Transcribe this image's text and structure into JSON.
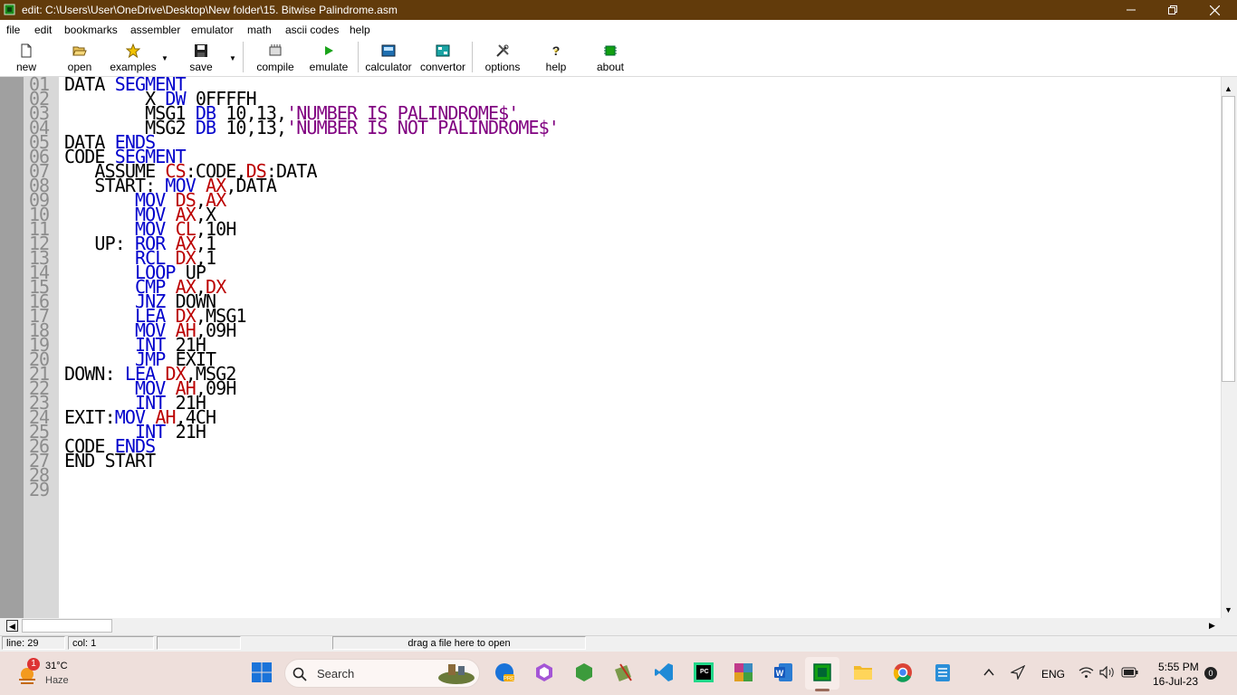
{
  "window": {
    "title": "edit: C:\\Users\\User\\OneDrive\\Desktop\\New folder\\15. Bitwise Palindrome.asm",
    "controls": [
      "minimize-icon",
      "restore-icon",
      "close-icon"
    ]
  },
  "menu": [
    "file",
    "edit",
    "bookmarks",
    "assembler",
    "emulator",
    "math",
    "ascii codes",
    "help"
  ],
  "toolbar": {
    "new": "new",
    "open": "open",
    "examples": "examples",
    "save": "save",
    "compile": "compile",
    "emulate": "emulate",
    "calculator": "calculator",
    "convertor": "convertor",
    "options": "options",
    "help": "help",
    "about": "about"
  },
  "editor": {
    "line_numbers": [
      "01",
      "02",
      "03",
      "04",
      "05",
      "06",
      "07",
      "08",
      "09",
      "10",
      "11",
      "12",
      "13",
      "14",
      "15",
      "16",
      "17",
      "18",
      "19",
      "20",
      "21",
      "22",
      "23",
      "24",
      "25",
      "26",
      "27",
      "28",
      "29"
    ],
    "lines": [
      [
        [
          "DATA ",
          "t"
        ],
        [
          "SEGMENT",
          "kw"
        ]
      ],
      [
        [
          "        X ",
          "t"
        ],
        [
          "DW",
          "kw"
        ],
        [
          " 0FFFFH",
          "t"
        ]
      ],
      [
        [
          "        MSG1 ",
          "t"
        ],
        [
          "DB",
          "kw"
        ],
        [
          " 10,13,",
          "t"
        ],
        [
          "'NUMBER IS PALINDROME$'",
          "st"
        ]
      ],
      [
        [
          "        MSG2 ",
          "t"
        ],
        [
          "DB",
          "kw"
        ],
        [
          " 10,13,",
          "t"
        ],
        [
          "'NUMBER IS NOT PALINDROME$'",
          "st"
        ]
      ],
      [
        [
          "DATA ",
          "t"
        ],
        [
          "ENDS",
          "kw"
        ]
      ],
      [
        [
          "CODE ",
          "t"
        ],
        [
          "SEGMENT",
          "kw"
        ]
      ],
      [
        [
          "   ASSUME ",
          "t"
        ],
        [
          "CS",
          "rg"
        ],
        [
          ":CODE,",
          "t"
        ],
        [
          "DS",
          "rg"
        ],
        [
          ":DATA",
          "t"
        ]
      ],
      [
        [
          "   START: ",
          "t"
        ],
        [
          "MOV",
          "kw"
        ],
        [
          " ",
          "t"
        ],
        [
          "AX",
          "rg"
        ],
        [
          ",DATA",
          "t"
        ]
      ],
      [
        [
          "       ",
          "t"
        ],
        [
          "MOV",
          "kw"
        ],
        [
          " ",
          "t"
        ],
        [
          "DS",
          "rg"
        ],
        [
          ",",
          "t"
        ],
        [
          "AX",
          "rg"
        ]
      ],
      [
        [
          "       ",
          "t"
        ],
        [
          "MOV",
          "kw"
        ],
        [
          " ",
          "t"
        ],
        [
          "AX",
          "rg"
        ],
        [
          ",X",
          "t"
        ]
      ],
      [
        [
          "       ",
          "t"
        ],
        [
          "MOV",
          "kw"
        ],
        [
          " ",
          "t"
        ],
        [
          "CL",
          "rg"
        ],
        [
          ",10H",
          "t"
        ]
      ],
      [
        [
          "   UP: ",
          "t"
        ],
        [
          "ROR",
          "kw"
        ],
        [
          " ",
          "t"
        ],
        [
          "AX",
          "rg"
        ],
        [
          ",1",
          "t"
        ]
      ],
      [
        [
          "       ",
          "t"
        ],
        [
          "RCL",
          "kw"
        ],
        [
          " ",
          "t"
        ],
        [
          "DX",
          "rg"
        ],
        [
          ",1",
          "t"
        ]
      ],
      [
        [
          "       ",
          "t"
        ],
        [
          "LOOP",
          "kw"
        ],
        [
          " UP",
          "t"
        ]
      ],
      [
        [
          "       ",
          "t"
        ],
        [
          "CMP",
          "kw"
        ],
        [
          " ",
          "t"
        ],
        [
          "AX",
          "rg"
        ],
        [
          ",",
          "t"
        ],
        [
          "DX",
          "rg"
        ]
      ],
      [
        [
          "       ",
          "t"
        ],
        [
          "JNZ",
          "kw"
        ],
        [
          " DOWN",
          "t"
        ]
      ],
      [
        [
          "       ",
          "t"
        ],
        [
          "LEA",
          "kw"
        ],
        [
          " ",
          "t"
        ],
        [
          "DX",
          "rg"
        ],
        [
          ",MSG1",
          "t"
        ]
      ],
      [
        [
          "       ",
          "t"
        ],
        [
          "MOV",
          "kw"
        ],
        [
          " ",
          "t"
        ],
        [
          "AH",
          "rg"
        ],
        [
          ",09H",
          "t"
        ]
      ],
      [
        [
          "       ",
          "t"
        ],
        [
          "INT",
          "kw"
        ],
        [
          " 21H",
          "t"
        ]
      ],
      [
        [
          "       ",
          "t"
        ],
        [
          "JMP",
          "kw"
        ],
        [
          " EXIT",
          "t"
        ]
      ],
      [
        [
          "DOWN: ",
          "t"
        ],
        [
          "LEA",
          "kw"
        ],
        [
          " ",
          "t"
        ],
        [
          "DX",
          "rg"
        ],
        [
          ",MSG2",
          "t"
        ]
      ],
      [
        [
          "       ",
          "t"
        ],
        [
          "MOV",
          "kw"
        ],
        [
          " ",
          "t"
        ],
        [
          "AH",
          "rg"
        ],
        [
          ",09H",
          "t"
        ]
      ],
      [
        [
          "       ",
          "t"
        ],
        [
          "INT",
          "kw"
        ],
        [
          " 21H",
          "t"
        ]
      ],
      [
        [
          "EXIT:",
          "t"
        ],
        [
          "MOV",
          "kw"
        ],
        [
          " ",
          "t"
        ],
        [
          "AH",
          "rg"
        ],
        [
          ",4CH",
          "t"
        ]
      ],
      [
        [
          "       ",
          "t"
        ],
        [
          "INT",
          "kw"
        ],
        [
          " 21H",
          "t"
        ]
      ],
      [
        [
          "CODE ",
          "t"
        ],
        [
          "ENDS",
          "kw"
        ]
      ],
      [
        [
          "END START",
          "t"
        ]
      ],
      [
        [
          "",
          "t"
        ]
      ],
      [
        [
          "",
          "t"
        ]
      ]
    ]
  },
  "status": {
    "line": "line: 29",
    "col": "col: 1",
    "hint": "drag a file here to open"
  },
  "taskbar": {
    "weather_temp": "31°C",
    "weather_desc": "Haze",
    "weather_badge": "1",
    "search_label": "Search",
    "lang": "ENG",
    "time": "5:55 PM",
    "date": "16-Jul-23",
    "notification_count": "0"
  },
  "colors": {
    "titlebar": "#623b0b",
    "keyword": "#0000cc",
    "register": "#bb0000",
    "string": "#800080",
    "line_number": "#8c8c8c",
    "gutter": "#d8d8d8",
    "taskbar": "#eedfdb"
  }
}
